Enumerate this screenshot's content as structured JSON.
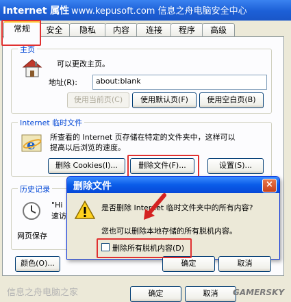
{
  "window": {
    "title": "Internet 属性",
    "watermark": "www.kepusoft.com 信息之舟电脑安全中心"
  },
  "tabs": [
    "常规",
    "安全",
    "隐私",
    "内容",
    "连接",
    "程序",
    "高级"
  ],
  "homepage": {
    "legend": "主页",
    "description": "可以更改主页。",
    "address_label": "地址(R):",
    "address_value": "about:blank",
    "buttons": {
      "use_current": "使用当前页(C)",
      "use_default": "使用默认页(F)",
      "use_blank": "使用空白页(B)"
    }
  },
  "temp_files": {
    "legend": "Internet 临时文件",
    "description_line1": "所查看的 Internet 页存储在特定的文件夹中，这样可以",
    "description_line2": "提高以后浏览的速度。",
    "buttons": {
      "delete_cookies": "删除 Cookies(I)...",
      "delete_files": "删除文件(F)...",
      "settings": "设置(S)..."
    }
  },
  "history": {
    "legend": "历史记录",
    "partial_line1": "\"Hi",
    "partial_line2": "速访",
    "partial_line3": "网页保存"
  },
  "bottom_buttons": {
    "colors": "颜色(O)..."
  },
  "dialog": {
    "title": "删除文件",
    "close": "×",
    "question": "是否删除 Internet 临时文件夹中的所有内容?",
    "offline_text": "您也可以删除本地存储的所有脱机内容。",
    "checkbox_label": "删除所有脱机内容(D)",
    "checkbox_checked": false,
    "ok": "确定",
    "cancel": "取消"
  },
  "footer": {
    "ok": "确定",
    "cancel": "取消",
    "watermark_left": "信息之舟电脑之家",
    "watermark_right": "GAMERSKY"
  }
}
